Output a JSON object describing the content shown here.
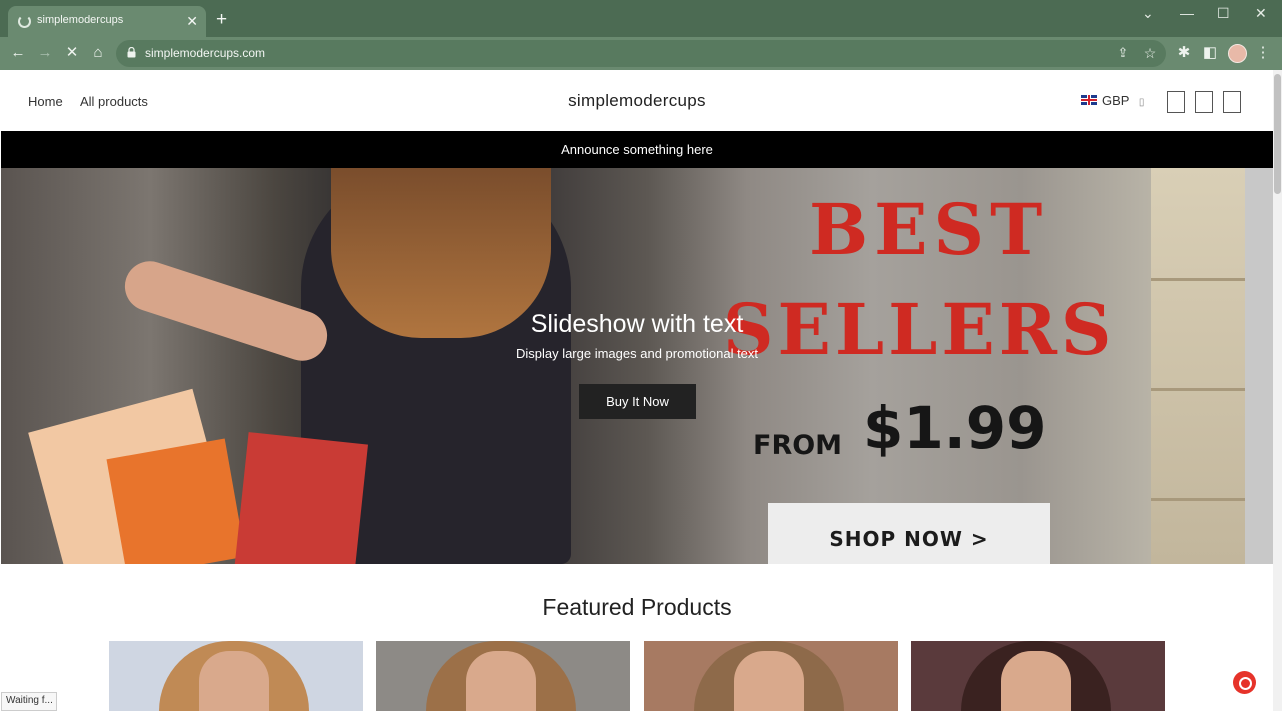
{
  "browser": {
    "tab_title": "simplemodercups",
    "tab_close": "✕",
    "new_tab": "+",
    "url": "simplemodercups.com",
    "status_text": "Waiting f..."
  },
  "site": {
    "nav": [
      "Home",
      "All products"
    ],
    "logo": "simplemodercups",
    "currency": "GBP",
    "announcement": "Announce something here"
  },
  "hero": {
    "slide_title": "Slideshow with text",
    "slide_subtitle": "Display large images and promotional text",
    "button_label": "Buy It Now",
    "promo_best": "BEST",
    "promo_sellers": "SELLERS",
    "promo_from": "FROM",
    "promo_price": "$1.99",
    "promo_shop": "SHOP NOW >"
  },
  "featured": {
    "heading": "Featured Products",
    "products": [
      {
        "image": "product-woman-light-blue-top",
        "bg": "#cfd6e2"
      },
      {
        "image": "product-woman-striped-top",
        "bg": "#8d8a86"
      },
      {
        "image": "product-woman-white-top",
        "bg": "#a77a62"
      },
      {
        "image": "product-woman-teal-cardigan",
        "bg": "#5a3a3c"
      }
    ]
  },
  "colors": {
    "browser_frame": "#4c6b53",
    "announcement_bg": "#000000",
    "promo_red": "#cf2a22",
    "chat_button": "#e6332a"
  }
}
